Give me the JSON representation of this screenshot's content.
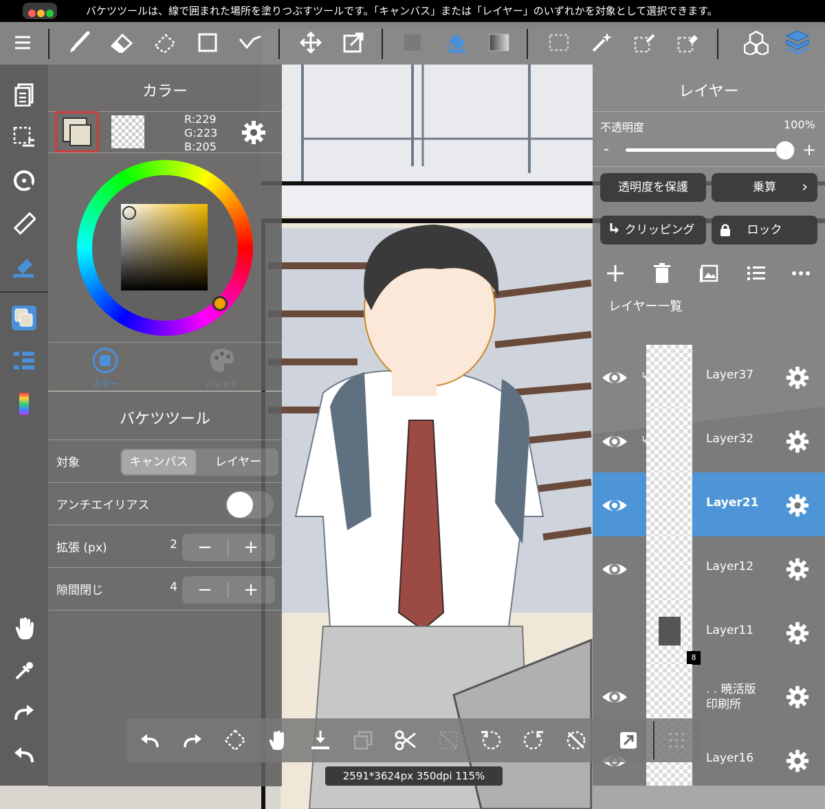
{
  "banner": {
    "text": "バケツツールは、線で囲まれた場所を塗りつぶすツールです。「キャンバス」または「レイヤー」のいずれかを対象として選択できます。"
  },
  "color_panel": {
    "title": "カラー",
    "rgb": {
      "r": "R:229",
      "g": "G:223",
      "b": "B:205"
    },
    "primary_color": "#e5dfcd",
    "tab_color": "カラー",
    "tab_palette": "パレット"
  },
  "bucket_panel": {
    "title": "バケツツール",
    "target_label": "対象",
    "target_options": [
      "キャンバス",
      "レイヤー"
    ],
    "target_selected": "キャンバス",
    "antialias_label": "アンチエイリアス",
    "expand_label": "拡張 (px)",
    "expand_value": "2",
    "gap_label": "隙間閉じ",
    "gap_value": "4"
  },
  "layer_panel": {
    "title": "レイヤー",
    "opacity_label": "不透明度",
    "opacity_value": "100%",
    "opacity_fraction": 1.0,
    "protect_alpha": "透明度を保護",
    "blend_mode": "乗算",
    "clipping": "クリッピング",
    "lock": "ロック",
    "list_title": "レイヤー一覧",
    "layers": [
      {
        "name": "Layer37",
        "selected": false
      },
      {
        "name": "Layer32",
        "selected": false
      },
      {
        "name": "Layer21",
        "selected": true
      },
      {
        "name": "Layer12",
        "selected": false
      },
      {
        "name": "Layer11",
        "selected": false,
        "badge": "8"
      },
      {
        "name": ". . 暁活版\n印刷所",
        "selected": false
      },
      {
        "name": "Layer16",
        "selected": false
      }
    ]
  },
  "status": {
    "text": "2591*3624px 350dpi 115%"
  },
  "colors": {
    "accent": "#4a90d9",
    "selected_layer": "#4d95d6",
    "swatch_border": "#d23b3b"
  }
}
